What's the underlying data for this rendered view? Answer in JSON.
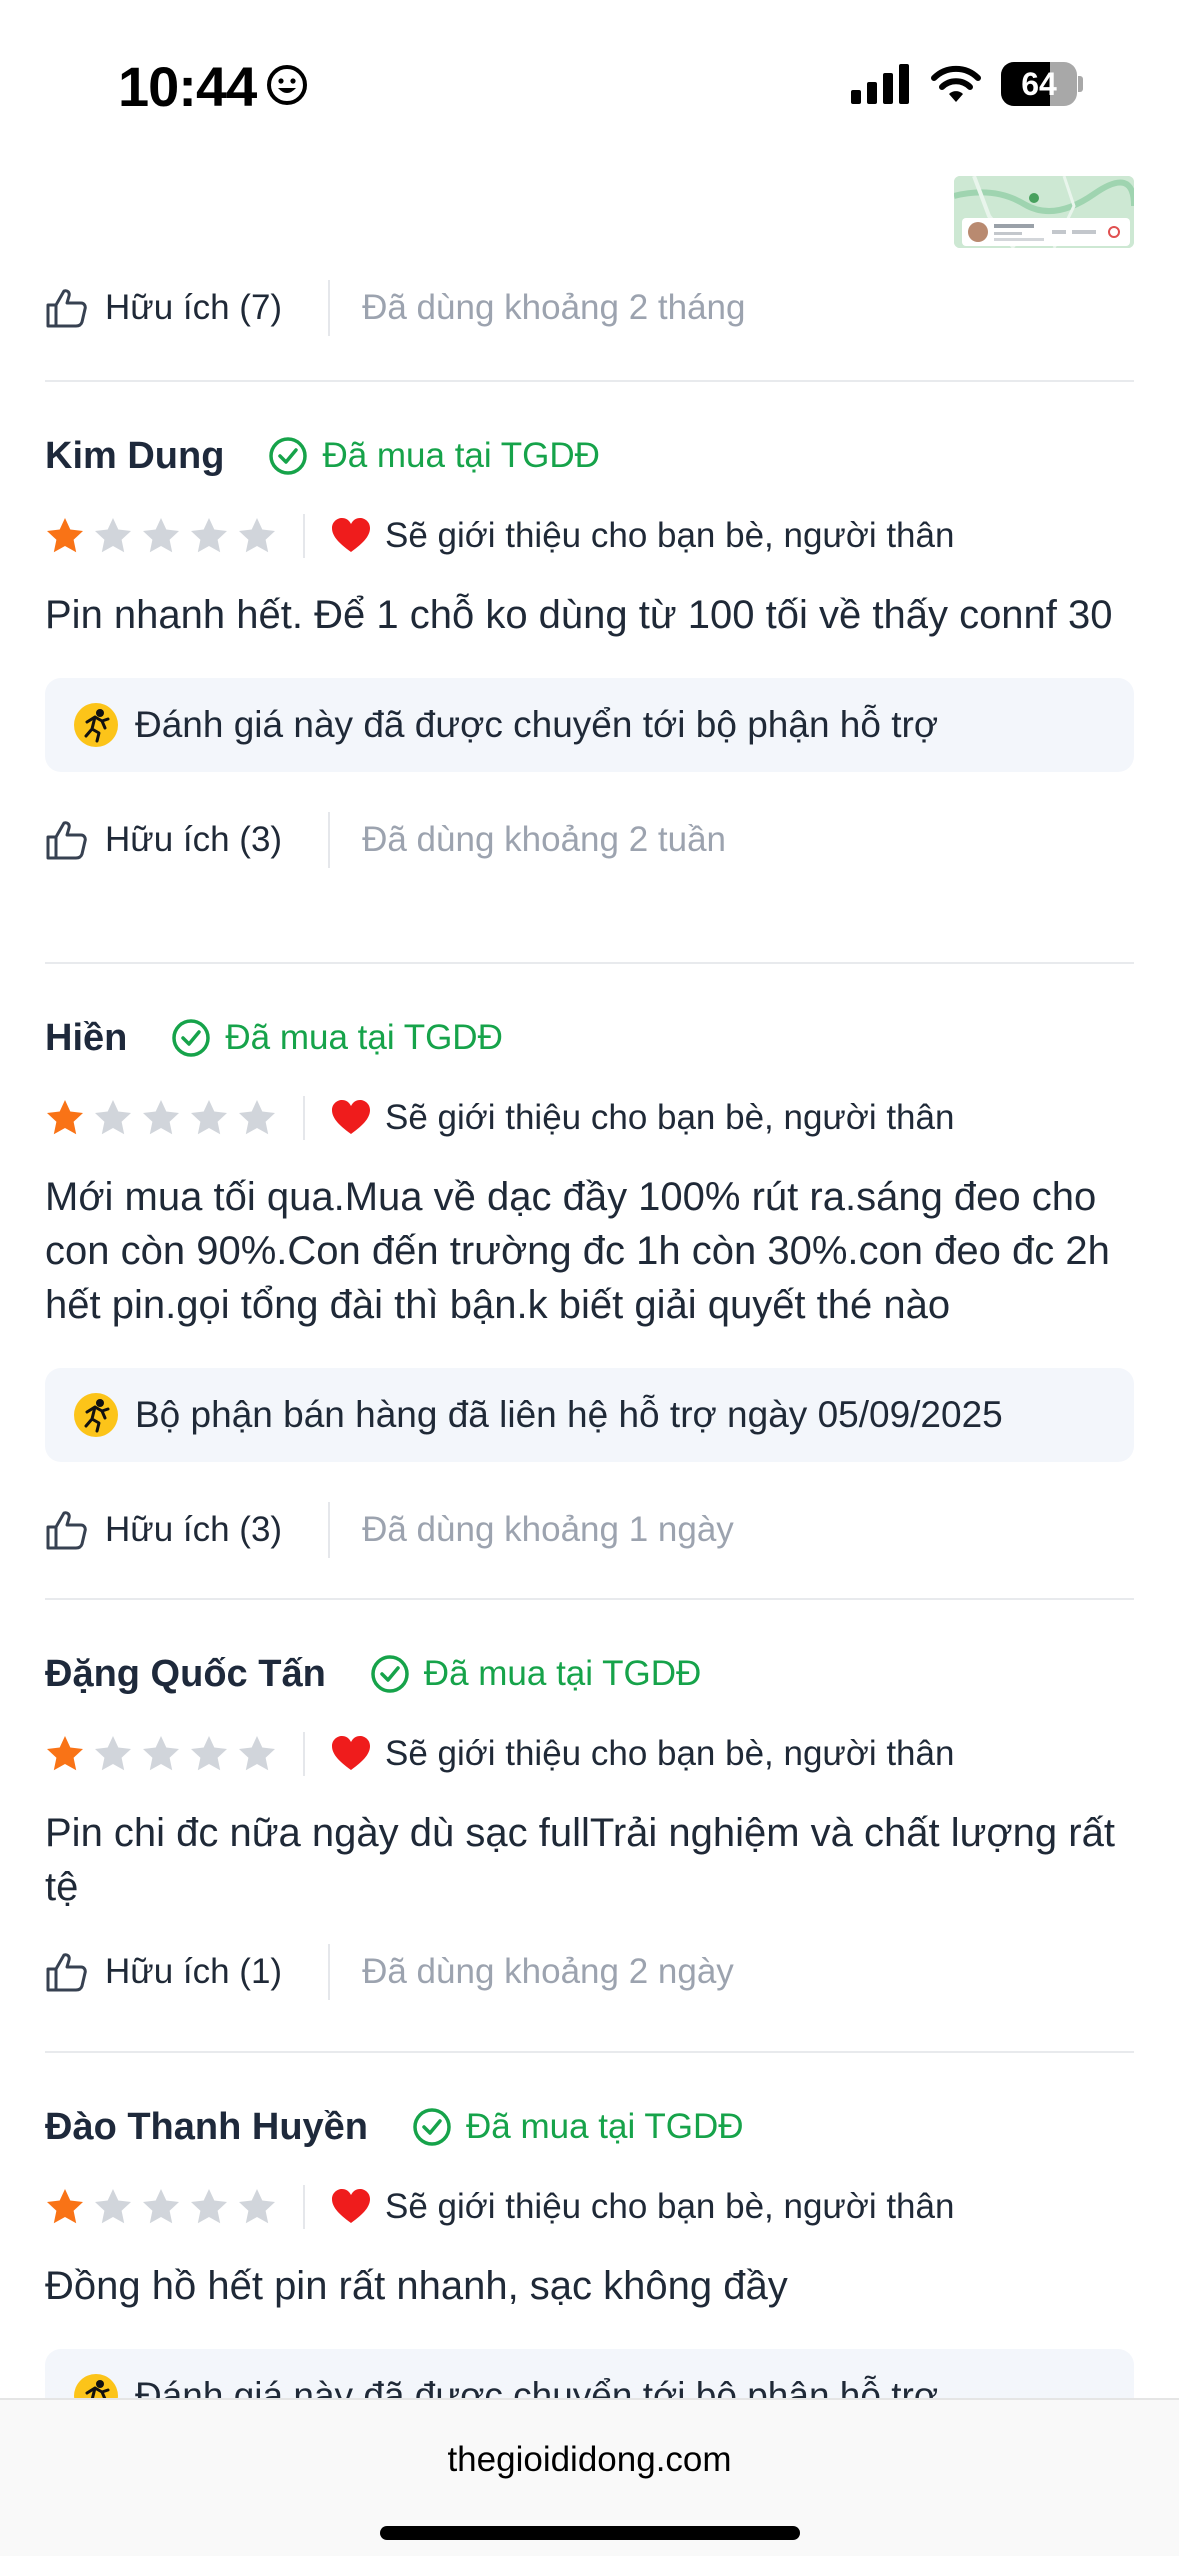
{
  "status_bar": {
    "time": "10:44",
    "battery": "64",
    "battery_level": 0.64,
    "emoji_icon": "smiley-face-icon",
    "signal_icon": "cellular-signal-icon",
    "wifi_icon": "wifi-icon"
  },
  "colors": {
    "verified_green": "#16a34a",
    "star_orange": "#f97316",
    "star_empty": "#d1d5db",
    "heart_red": "#ef1c1c",
    "notice_bg": "#f3f6fb",
    "muted_text": "#9ca3af"
  },
  "prev_review_footer": {
    "helpful_label": "Hữu ích (7)",
    "used_duration": "Đã dùng khoảng 2 tháng"
  },
  "reviews": [
    {
      "name": "Kim Dung",
      "verified_label": "Đã mua tại TGDĐ",
      "rating": 1,
      "max_rating": 5,
      "recommend_label": "Sẽ giới thiệu cho bạn bè, người thân",
      "body": "Pin nhanh hết. Để 1 chỗ ko dùng từ 100 tối về thấy connf 30",
      "notice": "Đánh giá này đã được chuyển tới bộ phận hỗ trợ",
      "helpful_label": "Hữu ích (3)",
      "used_duration": "Đã dùng khoảng 2 tuần"
    },
    {
      "name": "Hiền",
      "verified_label": "Đã mua tại TGDĐ",
      "rating": 1,
      "max_rating": 5,
      "recommend_label": "Sẽ giới thiệu cho bạn bè, người thân",
      "body": "Mới mua tối qua.Mua về dạc đầy 100% rút ra.sáng đeo cho con còn 90%.Con đến trường đc 1h còn 30%.con đeo đc 2h hết pin.gọi tổng đài thì bận.k biết giải quyết thé nào",
      "notice": "Bộ phận bán hàng đã liên hệ hỗ trợ ngày 05/09/2025",
      "helpful_label": "Hữu ích (3)",
      "used_duration": "Đã dùng khoảng 1 ngày"
    },
    {
      "name": "Đặng Quốc Tấn",
      "verified_label": "Đã mua tại TGDĐ",
      "rating": 1,
      "max_rating": 5,
      "recommend_label": "Sẽ giới thiệu cho bạn bè, người thân",
      "body": "Pin chi đc nữa ngày dù sạc fullTrải nghiệm và chất lượng rất tệ",
      "helpful_label": "Hữu ích (1)",
      "used_duration": "Đã dùng khoảng 2 ngày"
    },
    {
      "name": "Đào Thanh Huyền",
      "verified_label": "Đã mua tại TGDĐ",
      "rating": 1,
      "max_rating": 5,
      "recommend_label": "Sẽ giới thiệu cho bạn bè, người thân",
      "body": "Đồng hồ hết pin rất nhanh, sạc không đầy",
      "notice": "Đánh giá này đã được chuyển tới bộ phận hỗ trợ"
    }
  ],
  "browser": {
    "url": "thegioididong.com"
  }
}
